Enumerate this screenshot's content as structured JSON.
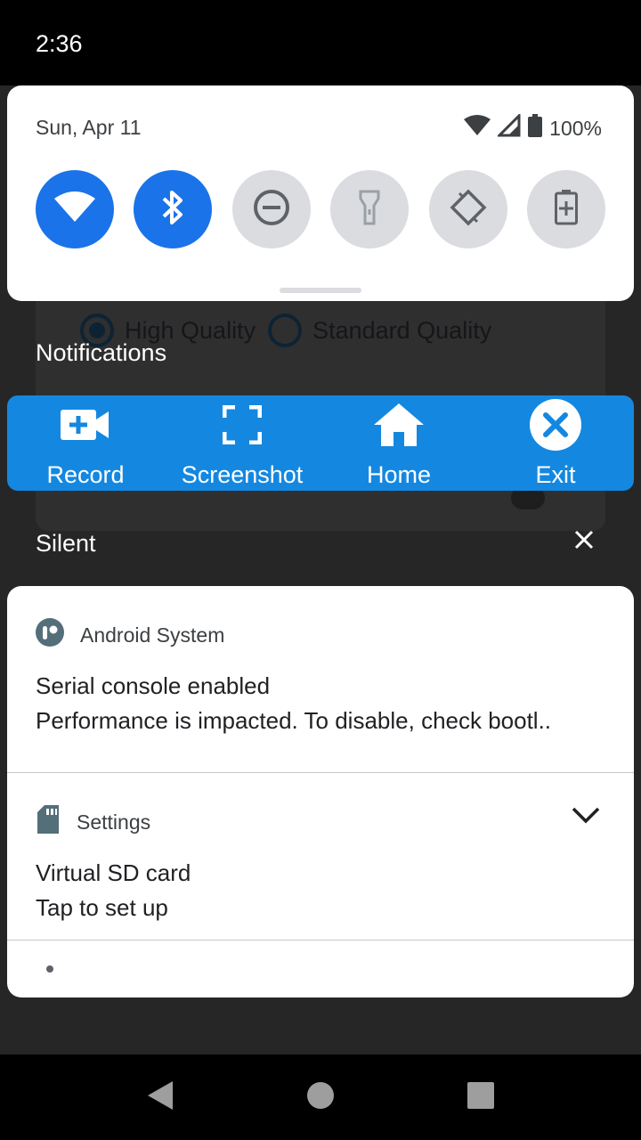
{
  "status_bar": {
    "time": "2:36"
  },
  "background_app": {
    "options": [
      "High Quality",
      "Standard Quality"
    ]
  },
  "quick_settings": {
    "date": "Sun, Apr 11",
    "battery": "100%",
    "tiles": [
      {
        "name": "wifi-icon",
        "on": true
      },
      {
        "name": "bluetooth-icon",
        "on": true
      },
      {
        "name": "do-not-disturb-icon",
        "on": false
      },
      {
        "name": "flashlight-icon",
        "on": false
      },
      {
        "name": "auto-rotate-icon",
        "on": false
      },
      {
        "name": "battery-saver-icon",
        "on": false
      }
    ]
  },
  "notifications_header": "Notifications",
  "floating_bar": {
    "record": "Record",
    "screenshot": "Screenshot",
    "home": "Home",
    "exit": "Exit"
  },
  "silent_header": "Silent",
  "notifications": [
    {
      "app": "Android System",
      "title": "Serial console enabled",
      "text": "Performance is impacted. To disable, check bootl.."
    },
    {
      "app": "Settings",
      "title": "Virtual SD card",
      "text": "Tap to set up"
    }
  ],
  "colors": {
    "accent": "#1a73e8",
    "floating_bar": "#1488e0",
    "scrim": "#262626"
  }
}
